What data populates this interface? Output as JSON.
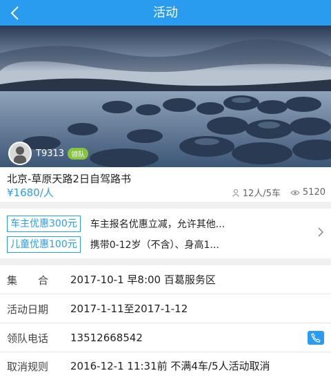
{
  "header": {
    "title": "活动"
  },
  "hero": {
    "leader": {
      "id": "T9313",
      "badge": "领队"
    }
  },
  "trip": {
    "title": "北京-草原天路2日自驾路书",
    "price": "¥1680/人",
    "participants": "12人/5车",
    "views": "5120"
  },
  "discounts": [
    {
      "tag": "车主优惠300元",
      "desc": "车主报名优惠立减，允许其他..."
    },
    {
      "tag": "儿童优惠100元",
      "desc": "携带0-12岁（不含）、身高1..."
    }
  ],
  "details": [
    {
      "label": "集　　合",
      "value": "2017-10-1 早8:00 百葛服务区"
    },
    {
      "label": "活动日期",
      "value": "2017-1-11至2017-1-12"
    },
    {
      "label": "领队电话",
      "value": "13512668542"
    },
    {
      "label": "取消规则",
      "value": "2016-12-1 11:31前 不满4车/5人活动取消"
    }
  ],
  "colors": {
    "accent": "#2a9cf0",
    "badge": "#86c440"
  },
  "icons": [
    "back-arrow-icon",
    "person-icon",
    "eye-icon",
    "chevron-right-icon",
    "phone-icon"
  ]
}
